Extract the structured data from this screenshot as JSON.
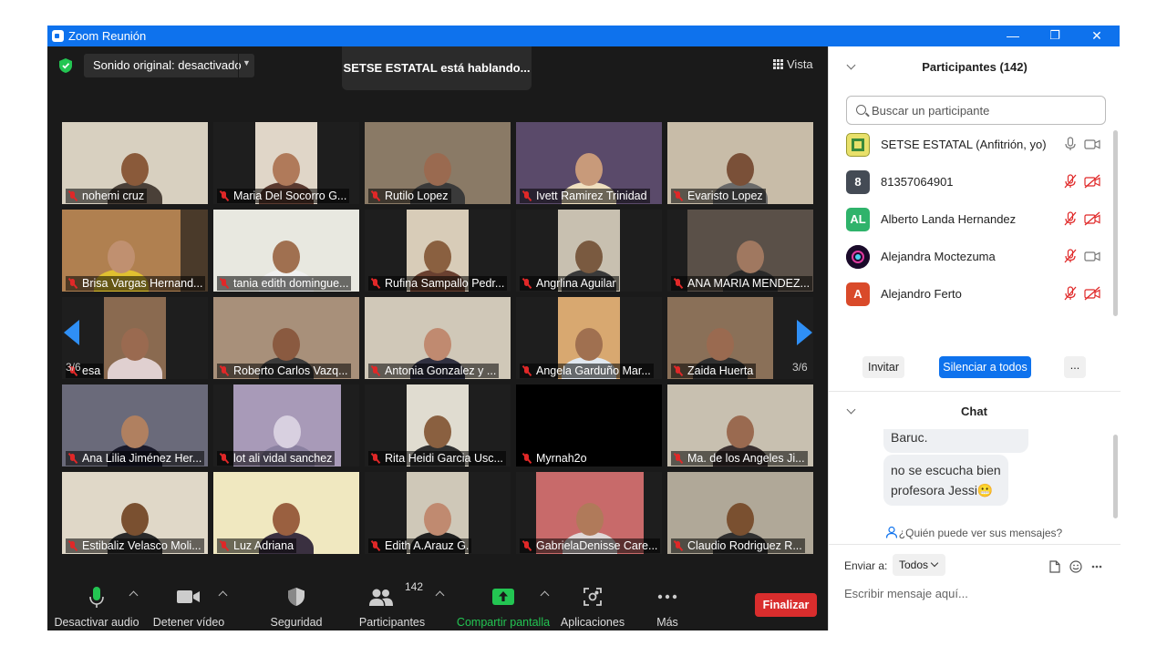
{
  "window": {
    "title": "Zoom Reunión",
    "minimize": "—",
    "restore": "❐",
    "close": "✕"
  },
  "top": {
    "audio_label": "Sonido original: desactivado",
    "speaking": "SETSE ESTATAL está hablando...",
    "view_label": "Vista"
  },
  "pager": {
    "left": "3/6",
    "right": "3/6"
  },
  "tiles": [
    "nohemi cruz",
    "Maria Del Socorro G...",
    "Rutilo Lopez",
    "Ivett Ramirez Trinidad",
    "Evaristo Lopez",
    "Brisa Vargas Hernand...",
    "tania edith domingue...",
    "Rufina Sampallo Pedr...",
    "Angrlina Aguilar",
    "ANA MARIA MENDEZ...",
    "esa",
    "Roberto Carlos Vazq...",
    "Antonia Gonzalez y ...",
    "Angela Garduño Mar...",
    "Zaida Huerta",
    "Ana Lilia Jiménez Her...",
    "lot ali vidal sanchez",
    "Rita Heidi Garcia Usc...",
    "Myrnah2o",
    "Ma. de los Angeles Ji...",
    "Estibaliz Velasco Moli...",
    "Luz Adriana",
    "Edith A.Arauz G.",
    "GabrielaDenisse Care...",
    "Claudio Rodriguez R..."
  ],
  "toolbar": {
    "mute": "Desactivar audio",
    "video": "Detener vídeo",
    "security": "Seguridad",
    "participants": "Participantes",
    "participants_count": "142",
    "share": "Compartir pantalla",
    "apps": "Aplicaciones",
    "more": "Más",
    "end": "Finalizar"
  },
  "participants_panel": {
    "title": "Participantes (142)",
    "search_placeholder": "Buscar un participante",
    "list": [
      {
        "name": "SETSE ESTATAL (Anfitrión, yo)",
        "avatar": "",
        "color": "#e8e06a"
      },
      {
        "name": "81357064901",
        "avatar": "8",
        "color": "#444b55"
      },
      {
        "name": "Alberto Landa Hernandez",
        "avatar": "AL",
        "color": "#2fb36b"
      },
      {
        "name": "Alejandra Moctezuma",
        "avatar": "",
        "color": "#2a1a3a"
      },
      {
        "name": "Alejandro Ferto",
        "avatar": "A",
        "color": "#d94a2a"
      }
    ],
    "invite": "Invitar",
    "mute_all": "Silenciar a todos",
    "more": "..."
  },
  "chat": {
    "title": "Chat",
    "messages": [
      "Baruc.",
      "no se escucha bien",
      "profesora Jessi😬"
    ],
    "who_can_see": "¿Quién puede ver sus mensajes?",
    "send_to_label": "Enviar a:",
    "send_to_value": "Todos",
    "input_placeholder": "Escribir mensaje aquí..."
  }
}
